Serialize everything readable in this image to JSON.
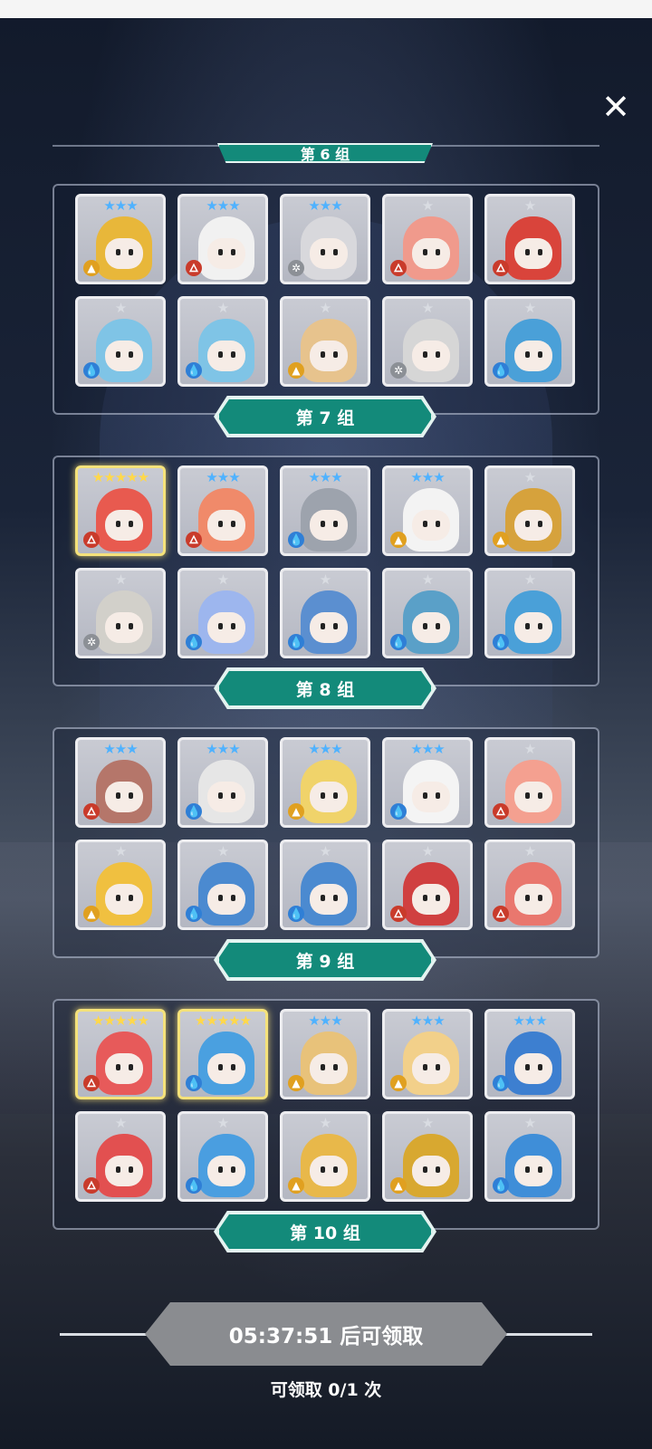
{
  "close_label": "✕",
  "partial_group_label": "第 6 组",
  "groups": [
    {
      "label": "第 7 组",
      "heroes": [
        {
          "stars": "★★★",
          "element": "light",
          "gold": false,
          "color": "#e8b73a",
          "icon": "hooded-knight-hero-icon"
        },
        {
          "stars": "★★★",
          "element": "fire",
          "gold": false,
          "color": "#f1f1f1",
          "icon": "bunny-hero-icon"
        },
        {
          "stars": "★★★",
          "element": "wind",
          "gold": false,
          "color": "#d8d8dc",
          "icon": "white-mage-hero-icon"
        },
        {
          "stars": "★",
          "element": "fire",
          "gold": false,
          "color": "#f09a8c",
          "icon": "bandaged-hero-icon"
        },
        {
          "stars": "★",
          "element": "fire",
          "gold": false,
          "color": "#d9443b",
          "icon": "red-beast-hero-icon"
        },
        {
          "stars": "★",
          "element": "water",
          "gold": false,
          "color": "#7fc4e6",
          "icon": "blue-cat-hero-icon"
        },
        {
          "stars": "★",
          "element": "water",
          "gold": false,
          "color": "#7fc4e6",
          "icon": "blue-cat-hero-icon"
        },
        {
          "stars": "★",
          "element": "light",
          "gold": false,
          "color": "#e7c38d",
          "icon": "pizza-hero-icon"
        },
        {
          "stars": "★",
          "element": "wind",
          "gold": false,
          "color": "#d6d6d6",
          "icon": "silver-hair-hero-icon"
        },
        {
          "stars": "★",
          "element": "water",
          "gold": false,
          "color": "#4aa0d8",
          "icon": "blue-shark-hero-icon"
        }
      ]
    },
    {
      "label": "第 8 组",
      "heroes": [
        {
          "stars": "★★★★★",
          "element": "fire",
          "gold": true,
          "color": "#e85a4f",
          "icon": "red-maid-hero-icon"
        },
        {
          "stars": "★★★",
          "element": "fire",
          "gold": false,
          "color": "#f08a6a",
          "icon": "coral-hair-hero-icon"
        },
        {
          "stars": "★★★",
          "element": "water",
          "gold": false,
          "color": "#9da3ad",
          "icon": "armored-knight-hero-icon"
        },
        {
          "stars": "★★★",
          "element": "light",
          "gold": false,
          "color": "#f3f3f3",
          "icon": "bunny-knight-hero-icon"
        },
        {
          "stars": "★",
          "element": "light",
          "gold": false,
          "color": "#d6a23c",
          "icon": "tree-hero-icon"
        },
        {
          "stars": "★",
          "element": "wind",
          "gold": false,
          "color": "#d2d0ca",
          "icon": "cactus-hero-icon"
        },
        {
          "stars": "★",
          "element": "water",
          "gold": false,
          "color": "#9db6ee",
          "icon": "elephant-hero-icon"
        },
        {
          "stars": "★",
          "element": "water",
          "gold": false,
          "color": "#5b8fd0",
          "icon": "witch-hero-icon"
        },
        {
          "stars": "★",
          "element": "water",
          "gold": false,
          "color": "#5aa0c8",
          "icon": "totem-hero-icon"
        },
        {
          "stars": "★",
          "element": "water",
          "gold": false,
          "color": "#4aa0d8",
          "icon": "blue-shark-hero-icon"
        }
      ]
    },
    {
      "label": "第 9 组",
      "heroes": [
        {
          "stars": "★★★",
          "element": "fire",
          "gold": false,
          "color": "#b5766a",
          "icon": "horned-warrior-hero-icon"
        },
        {
          "stars": "★★★",
          "element": "water",
          "gold": false,
          "color": "#e6e6e6",
          "icon": "ram-hero-icon"
        },
        {
          "stars": "★★★",
          "element": "light",
          "gold": false,
          "color": "#f0d36a",
          "icon": "mummy-hero-icon"
        },
        {
          "stars": "★★★",
          "element": "water",
          "gold": false,
          "color": "#f4f4f4",
          "icon": "ninja-hero-icon"
        },
        {
          "stars": "★",
          "element": "fire",
          "gold": false,
          "color": "#f4a090",
          "icon": "red-hat-hero-icon"
        },
        {
          "stars": "★",
          "element": "light",
          "gold": false,
          "color": "#f0c040",
          "icon": "yellow-witch-hero-icon"
        },
        {
          "stars": "★",
          "element": "water",
          "gold": false,
          "color": "#4b8ad0",
          "icon": "blue-golem-hero-icon"
        },
        {
          "stars": "★",
          "element": "water",
          "gold": false,
          "color": "#4b8ad0",
          "icon": "blue-golem-hero-icon"
        },
        {
          "stars": "★",
          "element": "fire",
          "gold": false,
          "color": "#d04040",
          "icon": "card-soldier-hero-icon"
        },
        {
          "stars": "★",
          "element": "fire",
          "gold": false,
          "color": "#e9776e",
          "icon": "dragon-ring-hero-icon"
        }
      ]
    },
    {
      "label": "第 10 组",
      "heroes": [
        {
          "stars": "★★★★★",
          "element": "fire",
          "gold": true,
          "color": "#e75a5a",
          "icon": "bandaged-bird-hero-icon"
        },
        {
          "stars": "★★★★★",
          "element": "water",
          "gold": true,
          "color": "#4aa0e0",
          "icon": "blue-maid-hero-icon"
        },
        {
          "stars": "★★★",
          "element": "light",
          "gold": false,
          "color": "#e8c27a",
          "icon": "unicorn-hero-icon"
        },
        {
          "stars": "★★★",
          "element": "light",
          "gold": false,
          "color": "#f2d08a",
          "icon": "chef-hero-icon"
        },
        {
          "stars": "★★★",
          "element": "water",
          "gold": false,
          "color": "#3d7fd0",
          "icon": "blue-mage-hero-icon"
        },
        {
          "stars": "★",
          "element": "fire",
          "gold": false,
          "color": "#e25050",
          "icon": "red-bear-hero-icon"
        },
        {
          "stars": "★",
          "element": "water",
          "gold": false,
          "color": "#4a9ee0",
          "icon": "blue-bear-hero-icon"
        },
        {
          "stars": "★",
          "element": "light",
          "gold": false,
          "color": "#e8b84a",
          "icon": "gold-knight-hero-icon"
        },
        {
          "stars": "★",
          "element": "light",
          "gold": false,
          "color": "#d8a830",
          "icon": "treasure-chest-hero-icon"
        },
        {
          "stars": "★",
          "element": "water",
          "gold": false,
          "color": "#3f8ed8",
          "icon": "blue-robot-hero-icon"
        }
      ]
    }
  ],
  "element_glyphs": {
    "fire": "🜂",
    "water": "💧",
    "light": "▲",
    "wind": "✲"
  },
  "claim": {
    "button_label": "05:37:51 后可领取",
    "count_label": "可领取 0/1 次"
  }
}
